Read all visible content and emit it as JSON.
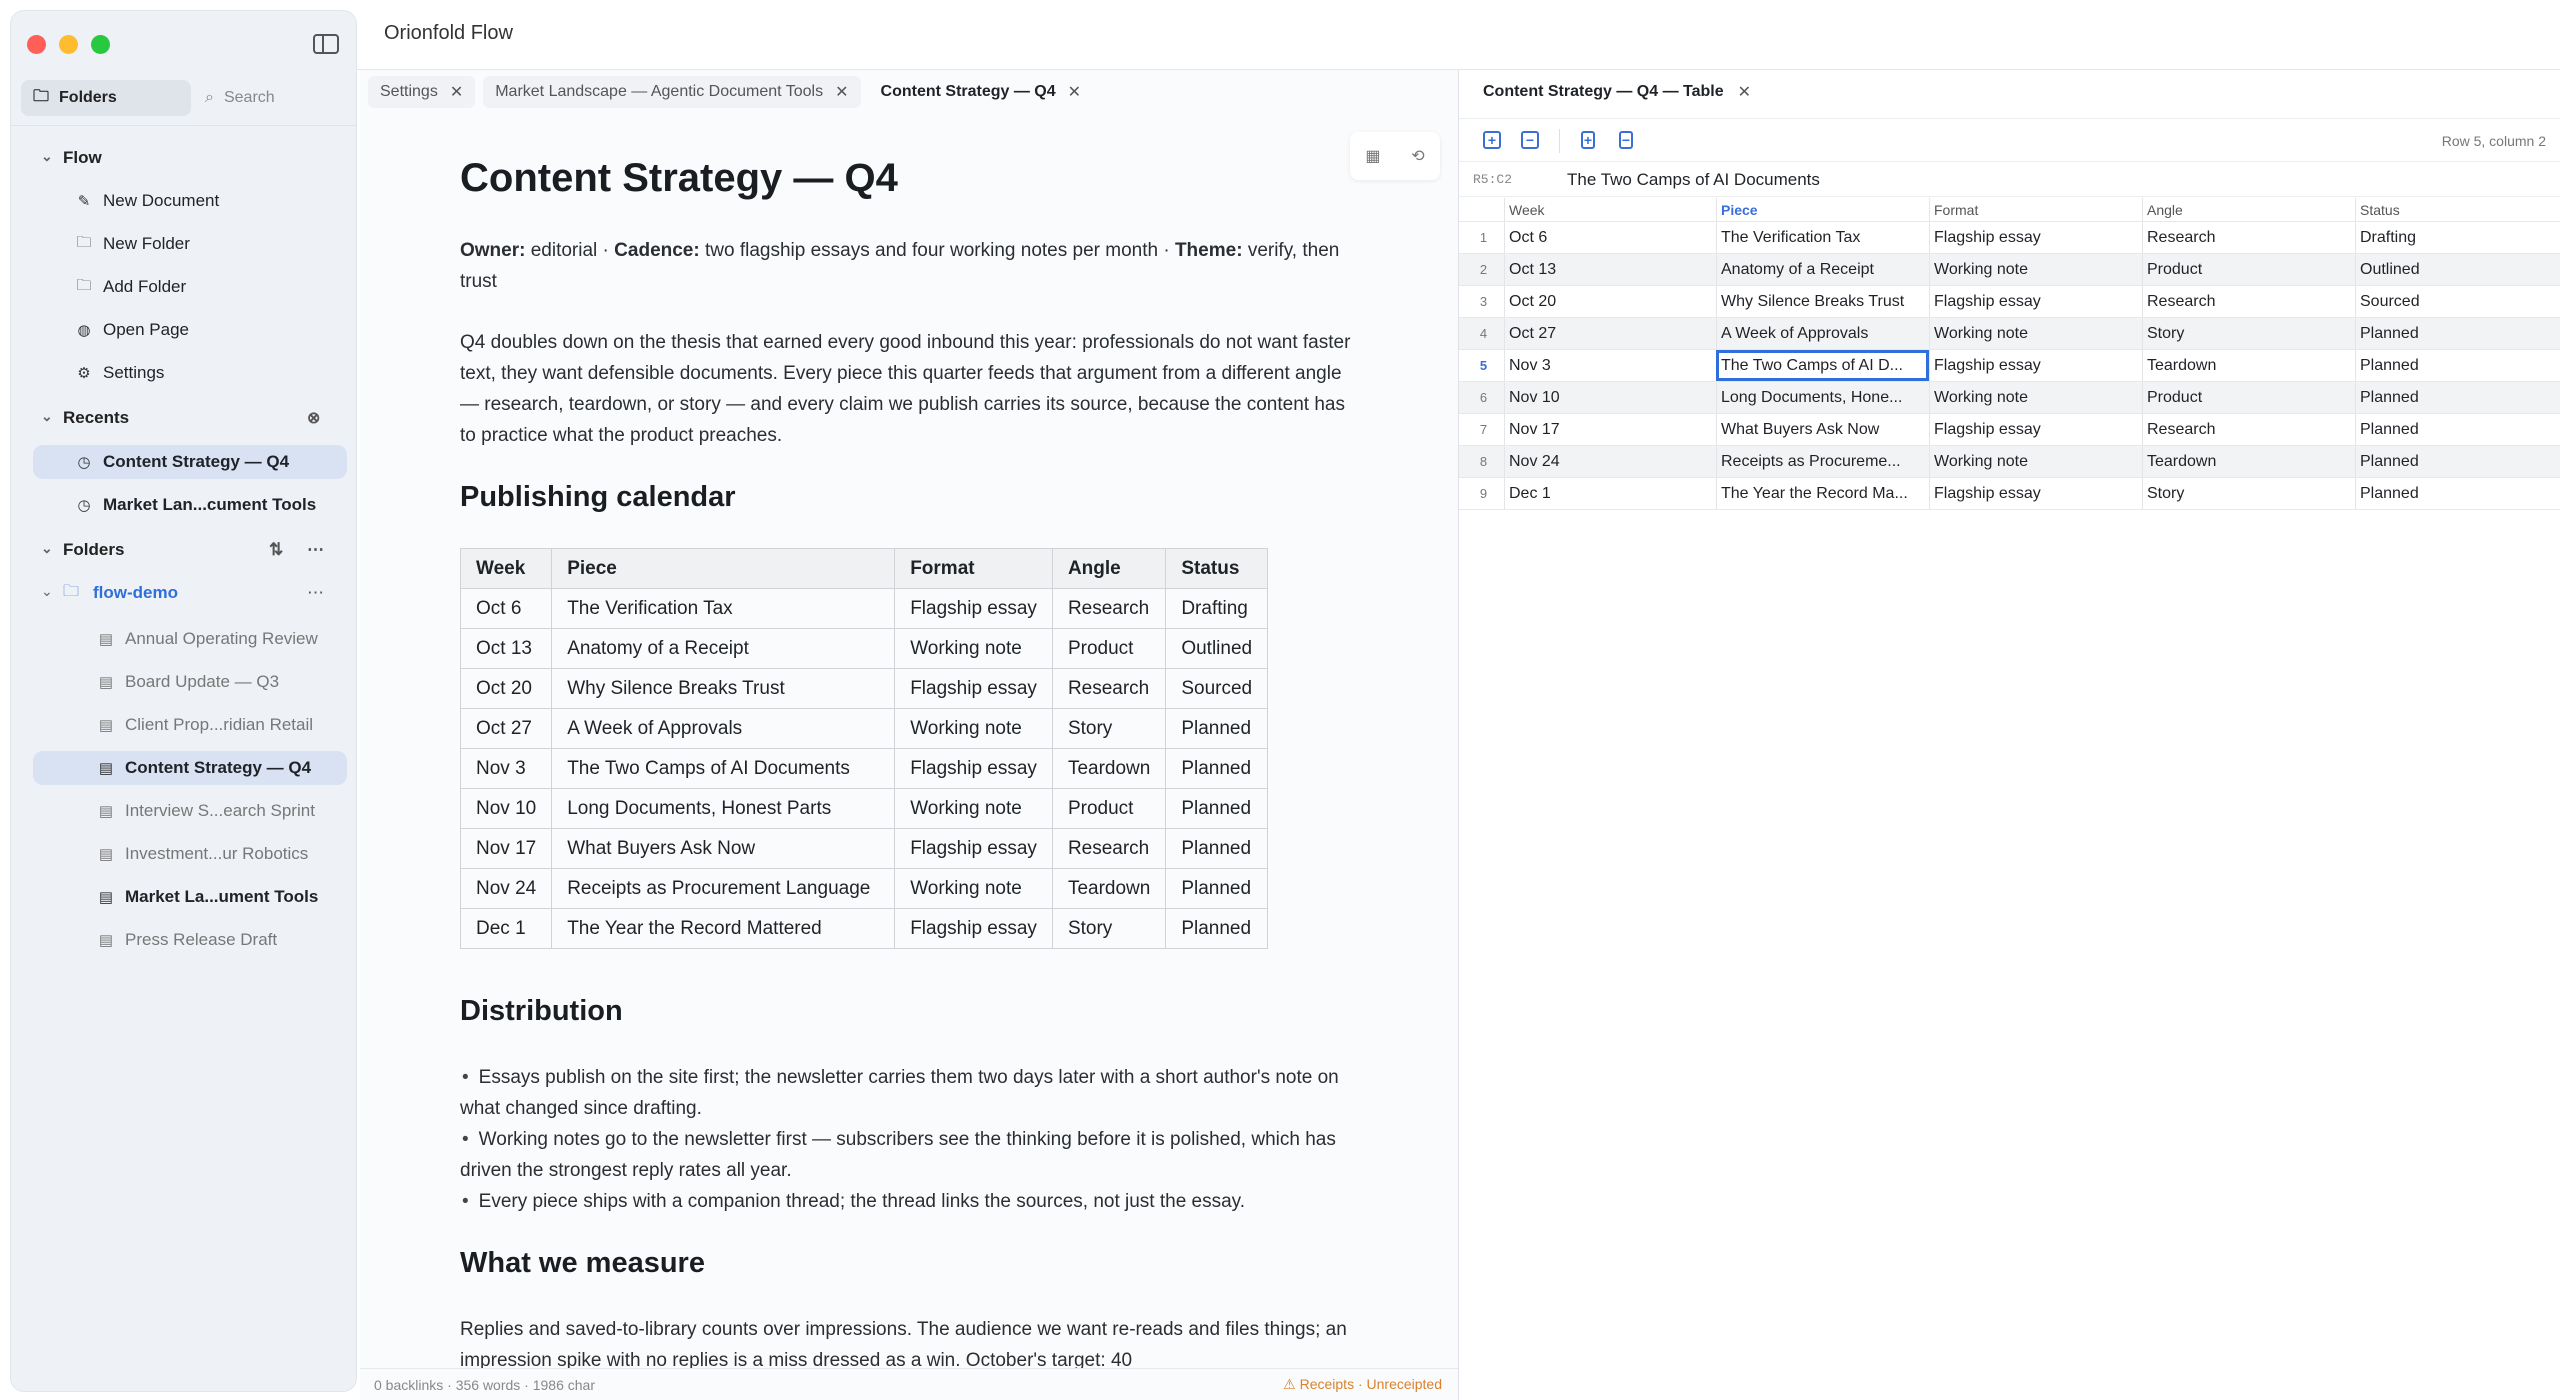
{
  "app": {
    "title": "Orionfold Flow"
  },
  "sidebar": {
    "folders_tab": "Folders",
    "search_placeholder": "Search",
    "flow": {
      "label": "Flow",
      "items": [
        {
          "label": "New Document",
          "icon": "new-document-icon"
        },
        {
          "label": "New Folder",
          "icon": "new-folder-icon"
        },
        {
          "label": "Add Folder",
          "icon": "add-folder-icon"
        },
        {
          "label": "Open Page",
          "icon": "globe-icon"
        },
        {
          "label": "Settings",
          "icon": "gear-icon"
        }
      ]
    },
    "recents": {
      "label": "Recents",
      "items": [
        {
          "label": "Content Strategy — Q4"
        },
        {
          "label": "Market Lan...cument Tools"
        }
      ]
    },
    "folders": {
      "label": "Folders",
      "folder": "flow-demo",
      "files": [
        {
          "label": "Annual Operating Review"
        },
        {
          "label": "Board Update — Q3"
        },
        {
          "label": "Client Prop...ridian Retail"
        },
        {
          "label": "Content Strategy — Q4"
        },
        {
          "label": "Interview S...earch Sprint"
        },
        {
          "label": "Investment...ur Robotics"
        },
        {
          "label": "Market La...ument Tools"
        },
        {
          "label": "Press Release Draft"
        }
      ]
    }
  },
  "editor": {
    "tabs": [
      {
        "label": "Settings"
      },
      {
        "label": "Market Landscape — Agentic Document Tools"
      },
      {
        "label": "Content Strategy — Q4"
      }
    ],
    "doc": {
      "title": "Content Strategy — Q4",
      "meta": {
        "owner_label": "Owner:",
        "owner": "editorial",
        "cadence_label": "Cadence:",
        "cadence": "two flagship essays and four working notes per month",
        "theme_label": "Theme:",
        "theme": "verify, then trust"
      },
      "intro": "Q4 doubles down on the thesis that earned every good inbound this year: professionals do not want faster text, they want defensible documents. Every piece this quarter feeds that argument from a different angle — research, teardown, or story — and every claim we publish carries its source, because the content has to practice what the product preaches.",
      "calendar_heading": "Publishing calendar",
      "table": {
        "headers": [
          "Week",
          "Piece",
          "Format",
          "Angle",
          "Status"
        ],
        "rows": [
          [
            "Oct 6",
            "The Verification Tax",
            "Flagship essay",
            "Research",
            "Drafting"
          ],
          [
            "Oct 13",
            "Anatomy of a Receipt",
            "Working note",
            "Product",
            "Outlined"
          ],
          [
            "Oct 20",
            "Why Silence Breaks Trust",
            "Flagship essay",
            "Research",
            "Sourced"
          ],
          [
            "Oct 27",
            "A Week of Approvals",
            "Working note",
            "Story",
            "Planned"
          ],
          [
            "Nov 3",
            "The Two Camps of AI Documents",
            "Flagship essay",
            "Teardown",
            "Planned"
          ],
          [
            "Nov 10",
            "Long Documents, Honest Parts",
            "Working note",
            "Product",
            "Planned"
          ],
          [
            "Nov 17",
            "What Buyers Ask Now",
            "Flagship essay",
            "Research",
            "Planned"
          ],
          [
            "Nov 24",
            "Receipts as Procurement Language",
            "Working note",
            "Teardown",
            "Planned"
          ],
          [
            "Dec 1",
            "The Year the Record Mattered",
            "Flagship essay",
            "Story",
            "Planned"
          ]
        ]
      },
      "distribution_heading": "Distribution",
      "distribution": [
        "Essays publish on the site first; the newsletter carries them two days later with a short author's note on what changed since drafting.",
        "Working notes go to the newsletter first — subscribers see the thinking before it is polished, which has driven the strongest reply rates all year.",
        "Every piece ships with a companion thread; the thread links the sources, not just the essay."
      ],
      "measure_heading": "What we measure",
      "measure": "Replies and saved-to-library counts over impressions. The audience we want re-reads and files things; an impression spike with no replies is a miss dressed as a win. October's target: 40"
    },
    "status": {
      "counts": "0 backlinks · 356 words · 1986 char",
      "warning": "⚠ Receipts · Unreceipted"
    }
  },
  "table_pane": {
    "tab": "Content Strategy — Q4 — Table",
    "position": "Row 5, column 2",
    "cell_ref": "R5:C2",
    "cell_value": "The Two Camps of AI Documents",
    "headers": [
      "Week",
      "Piece",
      "Format",
      "Angle",
      "Status"
    ],
    "rows": [
      [
        "1",
        "Oct 6",
        "The Verification Tax",
        "Flagship essay",
        "Research",
        "Drafting"
      ],
      [
        "2",
        "Oct 13",
        "Anatomy of a Receipt",
        "Working note",
        "Product",
        "Outlined"
      ],
      [
        "3",
        "Oct 20",
        "Why Silence Breaks Trust",
        "Flagship essay",
        "Research",
        "Sourced"
      ],
      [
        "4",
        "Oct 27",
        "A Week of Approvals",
        "Working note",
        "Story",
        "Planned"
      ],
      [
        "5",
        "Nov 3",
        "The Two Camps of AI D...",
        "Flagship essay",
        "Teardown",
        "Planned"
      ],
      [
        "6",
        "Nov 10",
        "Long Documents, Hone...",
        "Working note",
        "Product",
        "Planned"
      ],
      [
        "7",
        "Nov 17",
        "What Buyers Ask Now",
        "Flagship essay",
        "Research",
        "Planned"
      ],
      [
        "8",
        "Nov 24",
        "Receipts as Procureme...",
        "Working note",
        "Teardown",
        "Planned"
      ],
      [
        "9",
        "Dec 1",
        "The Year the Record Ma...",
        "Flagship essay",
        "Story",
        "Planned"
      ]
    ],
    "selected_row": 5,
    "selected_col": 2
  },
  "colors": {
    "accent": "#3a6fd8",
    "selection": "#d8e2f3",
    "warning": "#d9822b"
  }
}
